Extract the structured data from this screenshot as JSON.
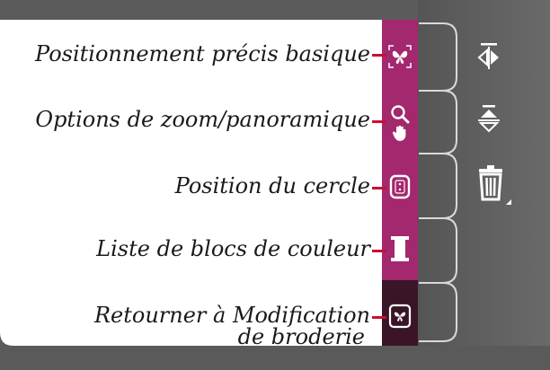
{
  "callouts": [
    {
      "label": "Positionnement précis basique",
      "icon": "precise-position-icon"
    },
    {
      "label": "Options de zoom/panoramique",
      "icon": "zoom-pan-icon"
    },
    {
      "label": "Position du cercle",
      "icon": "hoop-position-icon"
    },
    {
      "label": "Liste de blocs de couleur",
      "icon": "color-block-list-icon"
    },
    {
      "label": "Retourner à Modification de broderie",
      "line1": "Retourner à Modification",
      "line2": "de broderie",
      "icon": "return-edit-icon"
    }
  ],
  "right_icons": [
    "mirror-horizontal-icon",
    "mirror-vertical-icon",
    "delete-icon"
  ],
  "colors": {
    "panel": "#5b5b5b",
    "toolbar": "#a4286e",
    "toolbar_selected": "#3a1528",
    "leader": "#c8102e"
  }
}
